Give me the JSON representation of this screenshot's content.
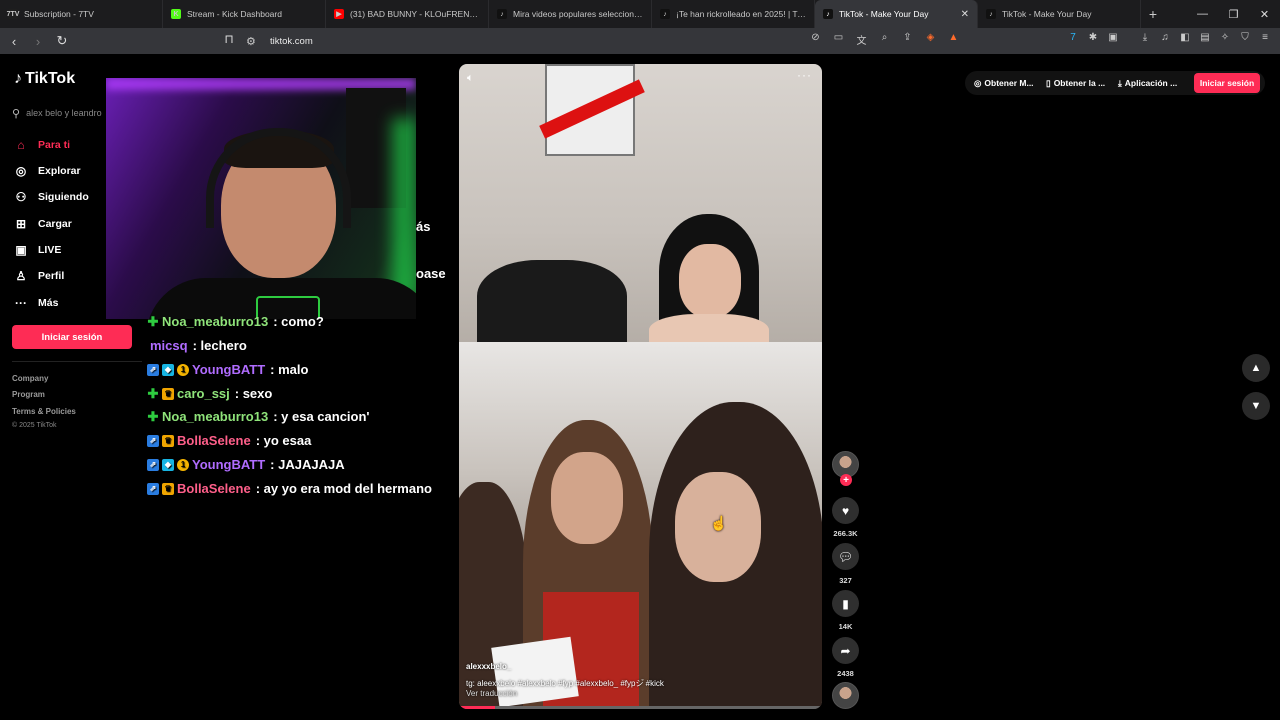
{
  "browser": {
    "tabs": [
      {
        "title": "Subscription - 7TV",
        "fav": "7TV",
        "favColor": "#1e1e1e"
      },
      {
        "title": "Stream - Kick Dashboard",
        "fav": "K",
        "favColor": "#53fc18"
      },
      {
        "title": "(31) BAD BUNNY - KLOuFRENS (Visu",
        "fav": "▶",
        "favColor": "#ff0000"
      },
      {
        "title": "Mira videos populares seleccionados",
        "fav": "♪",
        "favColor": "#111"
      },
      {
        "title": "¡Te han rickrolleado en 2025! | TikTok",
        "fav": "♪",
        "favColor": "#111"
      },
      {
        "title": "TikTok - Make Your Day",
        "fav": "♪",
        "favColor": "#111",
        "active": true
      },
      {
        "title": "TikTok - Make Your Day",
        "fav": "♪",
        "favColor": "#111"
      }
    ],
    "url": "tiktok.com",
    "brave_badge": "3"
  },
  "sidebar": {
    "brand": "TikTok",
    "search_placeholder": "alex belo y leandro",
    "items": [
      {
        "label": "Para ti",
        "icon": "home-icon"
      },
      {
        "label": "Explorar",
        "icon": "compass-icon"
      },
      {
        "label": "Siguiendo",
        "icon": "following-icon"
      },
      {
        "label": "Cargar",
        "icon": "upload-icon"
      },
      {
        "label": "LIVE",
        "icon": "live-icon"
      },
      {
        "label": "Perfil",
        "icon": "profile-icon"
      },
      {
        "label": "Más",
        "icon": "more-icon"
      }
    ],
    "login": "Iniciar sesión",
    "footer": [
      "Company",
      "Program",
      "Terms & Policies"
    ],
    "copyright": "© 2025 TikTok"
  },
  "chat": {
    "cut_lines": [
      "ás",
      "oase"
    ],
    "messages": [
      {
        "badges": [
          "green"
        ],
        "user": "Noa_meaburro13",
        "color": "#8fe37a",
        "text": ": como?"
      },
      {
        "badges": [],
        "user": "micsq",
        "color": "#b06cff",
        "text": ": lechero"
      },
      {
        "badges": [
          "blue",
          "cyan",
          "gold"
        ],
        "user": "YoungBATT",
        "color": "#b06cff",
        "text": ": malo"
      },
      {
        "badges": [
          "green",
          "crown"
        ],
        "user": "caro_ssj",
        "color": "#8fe37a",
        "text": ": sexo"
      },
      {
        "badges": [
          "green"
        ],
        "user": "Noa_meaburro13",
        "color": "#8fe37a",
        "text": ": y esa cancion'"
      },
      {
        "badges": [
          "blue",
          "crown"
        ],
        "user": "BollaSelene",
        "color": "#ff5f8a",
        "text": ": yo esaa"
      },
      {
        "badges": [
          "blue",
          "cyan",
          "gold"
        ],
        "user": "YoungBATT",
        "color": "#b06cff",
        "text": ": JAJAJAJA"
      },
      {
        "badges": [
          "blue",
          "crown"
        ],
        "user": "BollaSelene",
        "color": "#ff5f8a",
        "text": ": ay yo era mod del hermano"
      }
    ]
  },
  "video": {
    "author": "alexxxbelo_",
    "caption": "tg: aleexxbelo #alexxbelo #fyp #alexxbelo_ #fypシ゚ #kick",
    "translate": "Ver traducción",
    "progress": 0.1
  },
  "actions": {
    "likes": "266.3K",
    "comments": "327",
    "saves": "14K",
    "shares": "2438"
  },
  "header": {
    "btn1": "Obtener M...",
    "btn2": "Obtener la ...",
    "btn3": "Aplicación ...",
    "login": "Iniciar sesión"
  },
  "colors": {
    "accent": "#fe2c55"
  }
}
